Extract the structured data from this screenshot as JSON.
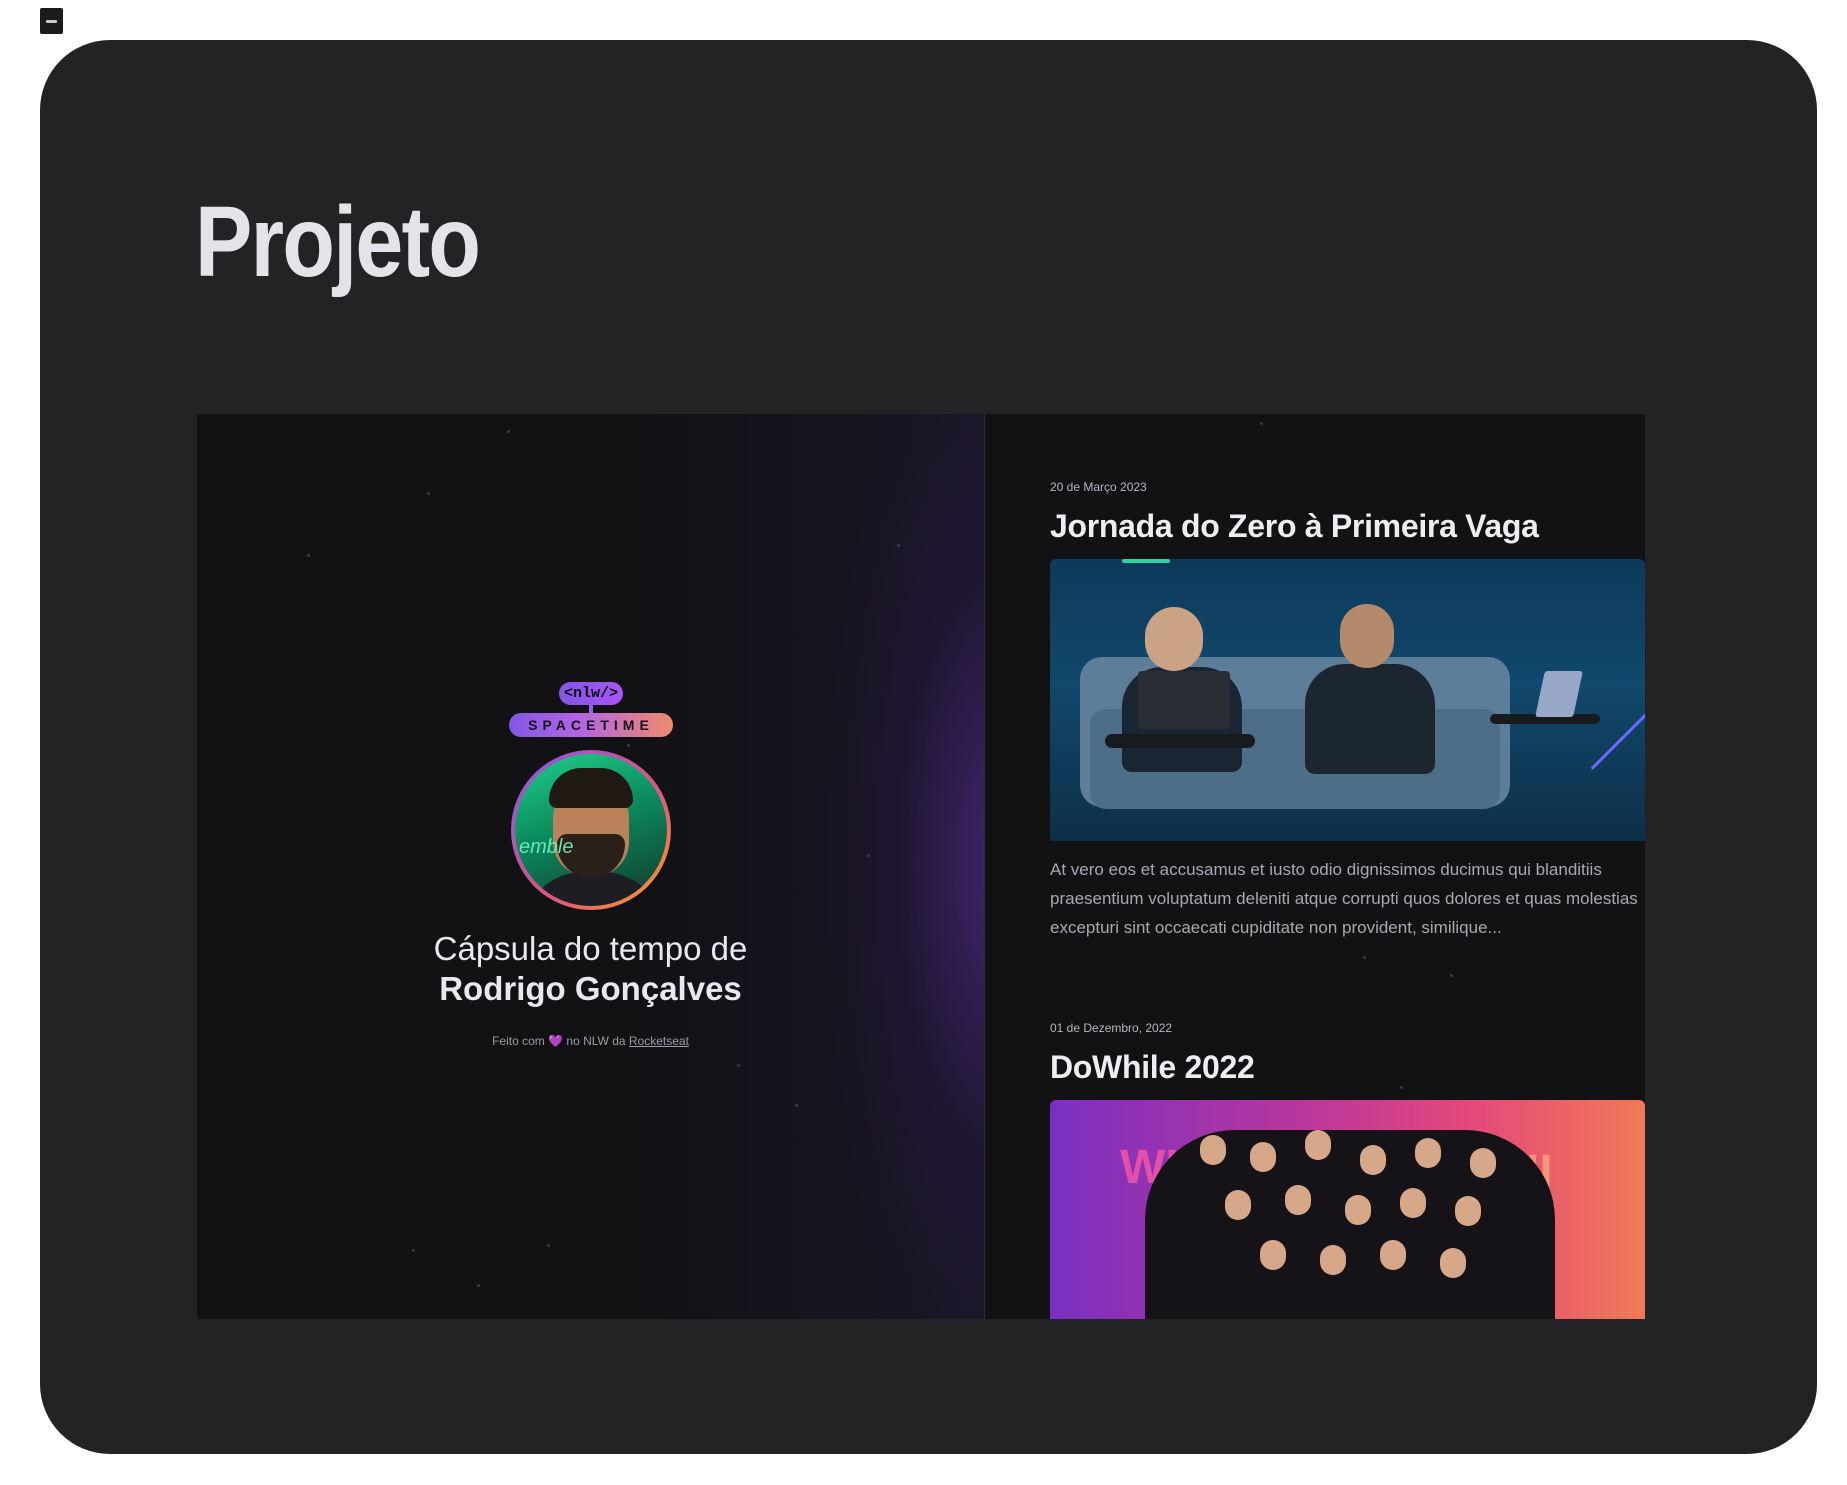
{
  "page": {
    "title": "Projeto"
  },
  "preview": {
    "brand": {
      "tag": "<nlw/>",
      "name": "SPACETIME"
    },
    "capsule": {
      "line1": "Cápsula do tempo de",
      "name": "Rodrigo Gonçalves",
      "footer_prefix": "Feito com",
      "footer_heart": "💜",
      "footer_middle": "no NLW da",
      "footer_link": "Rocketseat"
    },
    "entries": [
      {
        "date": "20 de Março 2023",
        "title": "Jornada do Zero à Primeira Vaga",
        "text": "At vero eos et accusamus et iusto odio dignissimos ducimus qui blanditiis praesentium voluptatum deleniti atque corrupti quos dolores et quas molestias excepturi sint occaecati cupiditate non provident, similique..."
      },
      {
        "date": "01 de Dezembro, 2022",
        "title": "DoWhile 2022",
        "image_text_left": "WH 20",
        "image_text_right": "ANI"
      }
    ]
  },
  "colors": {
    "frame_bg": "#232325",
    "panel_bg": "#121215",
    "accent_purple": "#8257e5",
    "accent_orange": "#f08a6b"
  },
  "icons": {
    "corner": "window-icon"
  }
}
